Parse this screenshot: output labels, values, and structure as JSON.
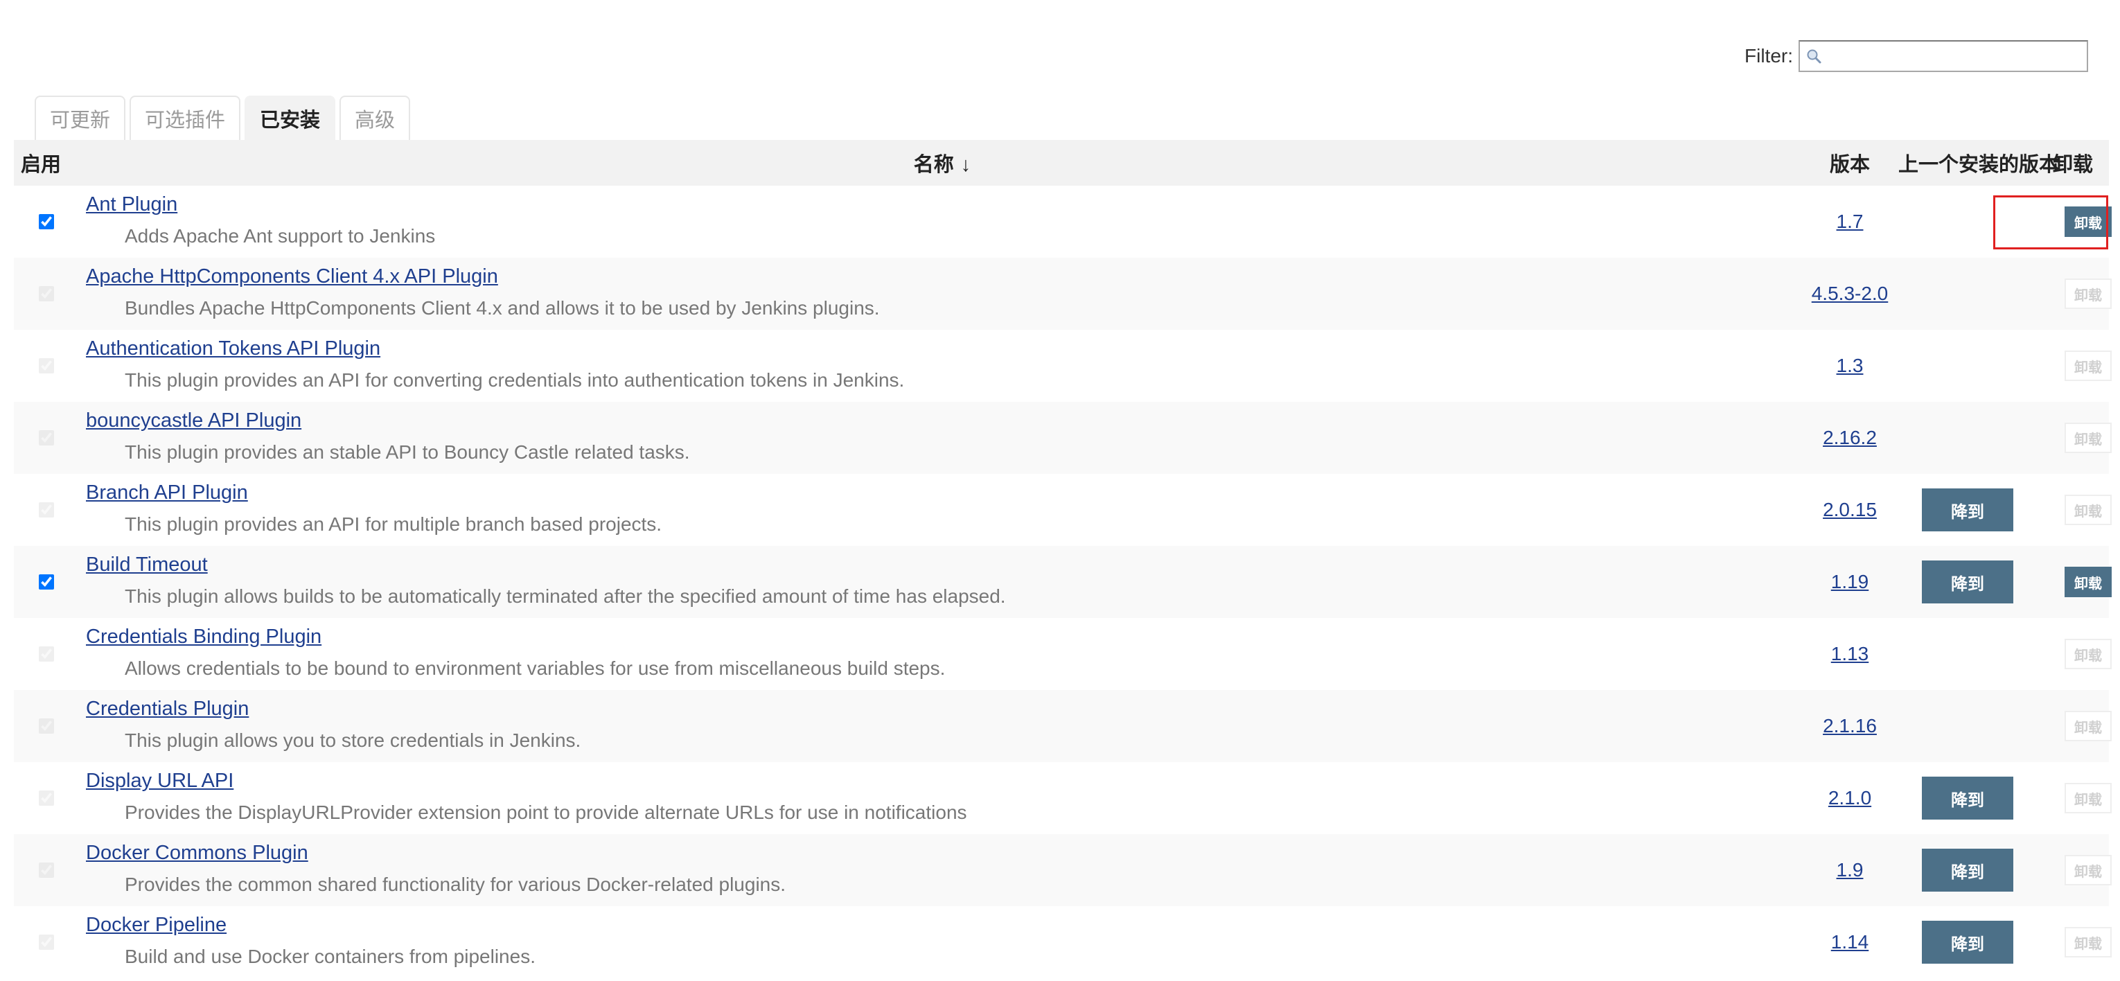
{
  "filter": {
    "label": "Filter:",
    "value": ""
  },
  "tabs": [
    {
      "label": "可更新",
      "active": false
    },
    {
      "label": "可选插件",
      "active": false
    },
    {
      "label": "已安装",
      "active": true
    },
    {
      "label": "高级",
      "active": false
    }
  ],
  "table": {
    "headers": {
      "enable": "启用",
      "name": "名称",
      "sort_arrow": "↓",
      "version": "版本",
      "previous": "上一个安装的版本",
      "uninstall": "卸载"
    },
    "downgrade_label": "降到",
    "uninstall_label": "卸载",
    "rows": [
      {
        "name": "Ant Plugin",
        "description": "Adds Apache Ant support to Jenkins",
        "version": "1.7",
        "checked": true,
        "enabled": true,
        "downgrade": false,
        "can_uninstall": true
      },
      {
        "name": "Apache HttpComponents Client 4.x API Plugin",
        "description": "Bundles Apache HttpComponents Client 4.x and allows it to be used by Jenkins plugins.",
        "version": "4.5.3-2.0",
        "checked": true,
        "enabled": false,
        "downgrade": false,
        "can_uninstall": false
      },
      {
        "name": "Authentication Tokens API Plugin",
        "description": "This plugin provides an API for converting credentials into authentication tokens in Jenkins.",
        "version": "1.3",
        "checked": true,
        "enabled": false,
        "downgrade": false,
        "can_uninstall": false
      },
      {
        "name": "bouncycastle API Plugin",
        "description": "This plugin provides an stable API to Bouncy Castle related tasks.",
        "version": "2.16.2",
        "checked": true,
        "enabled": false,
        "downgrade": false,
        "can_uninstall": false
      },
      {
        "name": "Branch API Plugin",
        "description": "This plugin provides an API for multiple branch based projects.",
        "version": "2.0.15",
        "checked": true,
        "enabled": false,
        "downgrade": true,
        "can_uninstall": false
      },
      {
        "name": "Build Timeout",
        "description": "This plugin allows builds to be automatically terminated after the specified amount of time has elapsed.",
        "version": "1.19",
        "checked": true,
        "enabled": true,
        "downgrade": true,
        "can_uninstall": true
      },
      {
        "name": "Credentials Binding Plugin",
        "description": "Allows credentials to be bound to environment variables for use from miscellaneous build steps.",
        "version": "1.13",
        "checked": true,
        "enabled": false,
        "downgrade": false,
        "can_uninstall": false
      },
      {
        "name": "Credentials Plugin",
        "description": "This plugin allows you to store credentials in Jenkins.",
        "version": "2.1.16",
        "checked": true,
        "enabled": false,
        "downgrade": false,
        "can_uninstall": false
      },
      {
        "name": "Display URL API",
        "description": "Provides the DisplayURLProvider extension point to provide alternate URLs for use in notifications",
        "version": "2.1.0",
        "checked": true,
        "enabled": false,
        "downgrade": true,
        "can_uninstall": false
      },
      {
        "name": "Docker Commons Plugin",
        "description": "Provides the common shared functionality for various Docker-related plugins.",
        "version": "1.9",
        "checked": true,
        "enabled": false,
        "downgrade": true,
        "can_uninstall": false
      },
      {
        "name": "Docker Pipeline",
        "description": "Build and use Docker containers from pipelines.",
        "version": "1.14",
        "checked": true,
        "enabled": false,
        "downgrade": true,
        "can_uninstall": false
      }
    ]
  }
}
